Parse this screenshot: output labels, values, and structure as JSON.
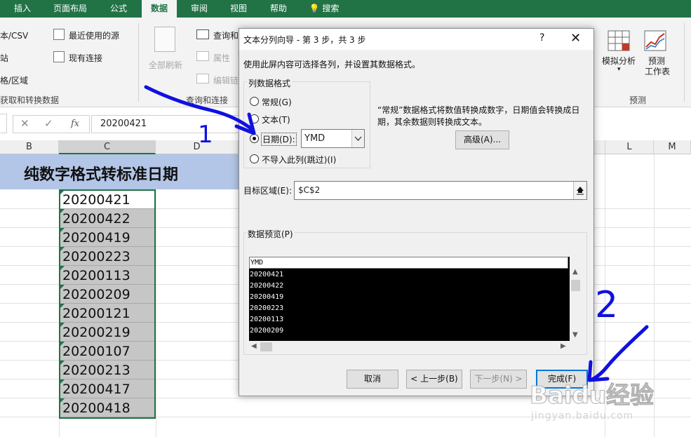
{
  "ribbon_tabs": [
    "插入",
    "页面布局",
    "公式",
    "数据",
    "审阅",
    "视图",
    "帮助",
    "搜索"
  ],
  "active_tab": "数据",
  "ribbon": {
    "get_data_items": [
      "本/CSV",
      "站",
      "格/区域"
    ],
    "get_data_group": "获取和转换数据",
    "recent_sources": "最近使用的源",
    "existing_connections": "现有连接",
    "refresh_all": "全部刷新",
    "queries": "查询和",
    "properties": "属性",
    "edit_links": "编辑链",
    "queries_group": "查询和连接",
    "whatif": "模拟分析",
    "forecast_line1": "预测",
    "forecast_line2": "工作表",
    "forecast_group": "预测"
  },
  "formula_bar": {
    "value": "20200421"
  },
  "columns": [
    "B",
    "C",
    "D",
    "L",
    "M"
  ],
  "sheet": {
    "title": "纯数字格式转标准日期",
    "values": [
      "20200421",
      "20200422",
      "20200419",
      "20200223",
      "20200113",
      "20200209",
      "20200121",
      "20200219",
      "20200107",
      "20200213",
      "20200417",
      "20200418"
    ]
  },
  "dialog": {
    "title": "文本分列向导 - 第 3 步，共 3 步",
    "help": "?",
    "close": "✕",
    "instruction": "使用此屏内容可选择各列，并设置其数据格式。",
    "format_legend": "列数据格式",
    "options": [
      "常规(G)",
      "文本(T)",
      "日期(D):",
      "不导入此列(跳过)(I)"
    ],
    "selected_option": "日期(D):",
    "date_format": "YMD",
    "description": "“常规”数据格式将数值转换成数字，日期值会转换成日期，其余数据则转换成文本。",
    "advanced_button": "高级(A)...",
    "target_label": "目标区域(E):",
    "target_value": "$C$2",
    "preview_legend": "数据预览(P)",
    "preview_header": "YMD",
    "preview_rows": [
      "20200421",
      "20200422",
      "20200419",
      "20200223",
      "20200113",
      "20200209"
    ],
    "cancel_button": "取消",
    "back_button": "< 上一步(B)",
    "next_button": "下一步(N) >",
    "finish_button": "完成(F)"
  },
  "annotations": {
    "step1": "1",
    "step2": "2",
    "color": "#1010e0"
  },
  "watermark": {
    "logo": "Baidu经验",
    "url": "jingyan.baidu.com"
  }
}
